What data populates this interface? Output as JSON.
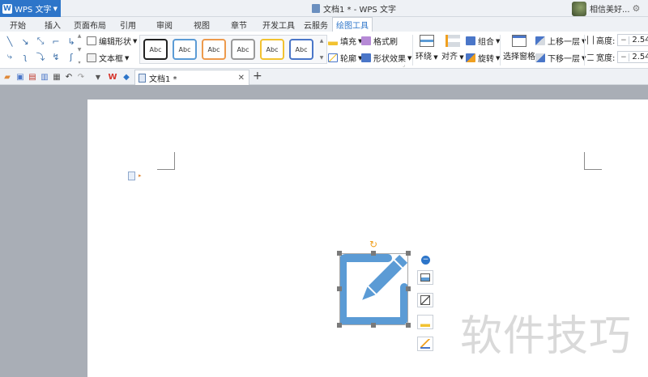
{
  "app": {
    "button_label": "WPS 文字",
    "window_title": "文档1 * - WPS 文字",
    "user_name": "相信美好..."
  },
  "tabs": [
    "开始",
    "插入",
    "页面布局",
    "引用",
    "审阅",
    "视图",
    "章节",
    "开发工具",
    "云服务",
    "绘图工具"
  ],
  "active_tab": "绘图工具",
  "ribbon": {
    "edit_shape": "编辑形状",
    "text_box": "文本框",
    "style_samples": [
      "Abc",
      "Abc",
      "Abc",
      "Abc",
      "Abc",
      "Abc"
    ],
    "style_colors": [
      "#222222",
      "#5b9bd5",
      "#ed9a4c",
      "#9a9a9a",
      "#f2c230",
      "#4a76c8"
    ],
    "fill": "填充",
    "format_painter": "格式刷",
    "outline": "轮廓",
    "shape_effects": "形状效果",
    "wrap": "环绕",
    "align": "对齐",
    "group": "组合",
    "rotate": "旋转",
    "selection_pane": "选择窗格",
    "bring_forward": "上移一层",
    "send_backward": "下移一层",
    "height_label": "高度:",
    "height_value": "2.54",
    "width_label": "宽度:",
    "width_value": "2.54"
  },
  "document_tab": {
    "name": "文档1 *"
  },
  "watermark": "软件技巧",
  "colors": {
    "accent": "#2d75c9",
    "shape_fill": "#5b9bd5"
  }
}
